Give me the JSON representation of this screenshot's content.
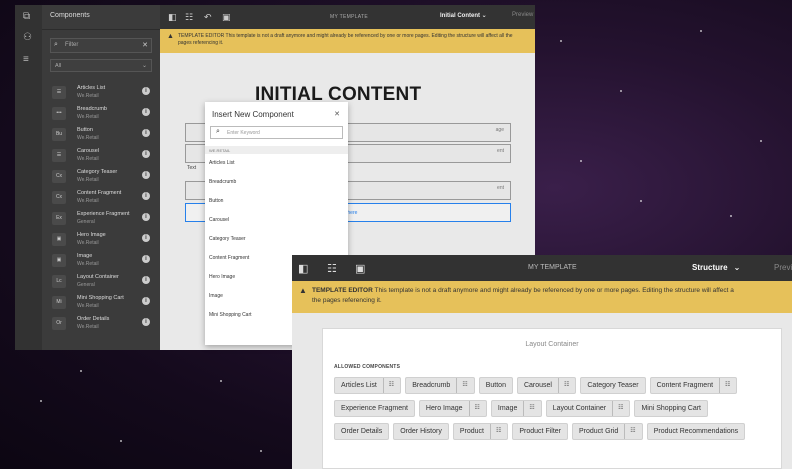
{
  "back_window": {
    "panel_title": "Components",
    "filter": {
      "placeholder": "Filter"
    },
    "group_select": "All",
    "components": [
      {
        "name": "Articles List",
        "group": "We.Retail",
        "icon": "list-icon"
      },
      {
        "name": "Breadcrumb",
        "group": "We.Retail",
        "icon": "more-icon"
      },
      {
        "name": "Button",
        "group": "We.Retail",
        "icon": "Bu"
      },
      {
        "name": "Carousel",
        "group": "We.Retail",
        "icon": "list-icon"
      },
      {
        "name": "Category Teaser",
        "group": "We.Retail",
        "icon": "Cx"
      },
      {
        "name": "Content Fragment",
        "group": "We.Retail",
        "icon": "Cx"
      },
      {
        "name": "Experience Fragment",
        "group": "General",
        "icon": "Ex"
      },
      {
        "name": "Hero Image",
        "group": "We.Retail",
        "icon": "image-icon"
      },
      {
        "name": "Image",
        "group": "We.Retail",
        "icon": "image-icon"
      },
      {
        "name": "Layout Container",
        "group": "General",
        "icon": "Lc"
      },
      {
        "name": "Mini Shopping Cart",
        "group": "We.Retail",
        "icon": "Mi"
      },
      {
        "name": "Order Details",
        "group": "We.Retail",
        "icon": "Or"
      }
    ],
    "toolbar": {
      "title": "MY TEMPLATE",
      "mode": "Initial Content",
      "preview": "Preview"
    },
    "warning": "TEMPLATE EDITOR This template is not a draft anymore and might already be referenced by one or more pages. Editing the structure will affect all the pages referencing it.",
    "canvas": {
      "heading": "INITIAL CONTENT",
      "slot_frag_1": "age",
      "slot_frag_2": "ent",
      "text_label": "Text",
      "slot_frag_3": "ent",
      "drag_text": "onents here"
    },
    "dialog": {
      "title": "Insert New Component",
      "search_placeholder": "Enter Keyword",
      "group_label": "WE.RETAIL",
      "items": [
        "Articles List",
        "Breadcrumb",
        "Button",
        "Carousel",
        "Category Teaser",
        "Content Fragment",
        "Hero Image",
        "Image",
        "Mini Shopping Cart"
      ]
    }
  },
  "front_window": {
    "toolbar": {
      "title": "MY TEMPLATE",
      "mode": "Structure",
      "preview": "Previ"
    },
    "warning": {
      "label": "TEMPLATE EDITOR",
      "text": " This template is not a draft anymore and might already be referenced by one or more pages. Editing the structure will affect a",
      "text2": "the pages referencing it."
    },
    "layout_container": {
      "title": "Layout Container",
      "allowed_label": "ALLOWED COMPONENTS",
      "rows": [
        [
          {
            "label": "Articles List",
            "config": true
          },
          {
            "label": "Breadcrumb",
            "config": true
          },
          {
            "label": "Button",
            "config": false
          },
          {
            "label": "Carousel",
            "config": true
          },
          {
            "label": "Category Teaser",
            "config": false
          },
          {
            "label": "Content Fragment",
            "config": true
          }
        ],
        [
          {
            "label": "Experience Fragment",
            "config": false
          },
          {
            "label": "Hero Image",
            "config": true
          },
          {
            "label": "Image",
            "config": true
          },
          {
            "label": "Layout Container",
            "config": true
          },
          {
            "label": "Mini Shopping Cart",
            "config": false
          }
        ],
        [
          {
            "label": "Order Details",
            "config": false
          },
          {
            "label": "Order History",
            "config": false
          },
          {
            "label": "Product",
            "config": true
          },
          {
            "label": "Product Filter",
            "config": false
          },
          {
            "label": "Product Grid",
            "config": true
          },
          {
            "label": "Product Recommendations",
            "config": false
          }
        ]
      ]
    }
  }
}
